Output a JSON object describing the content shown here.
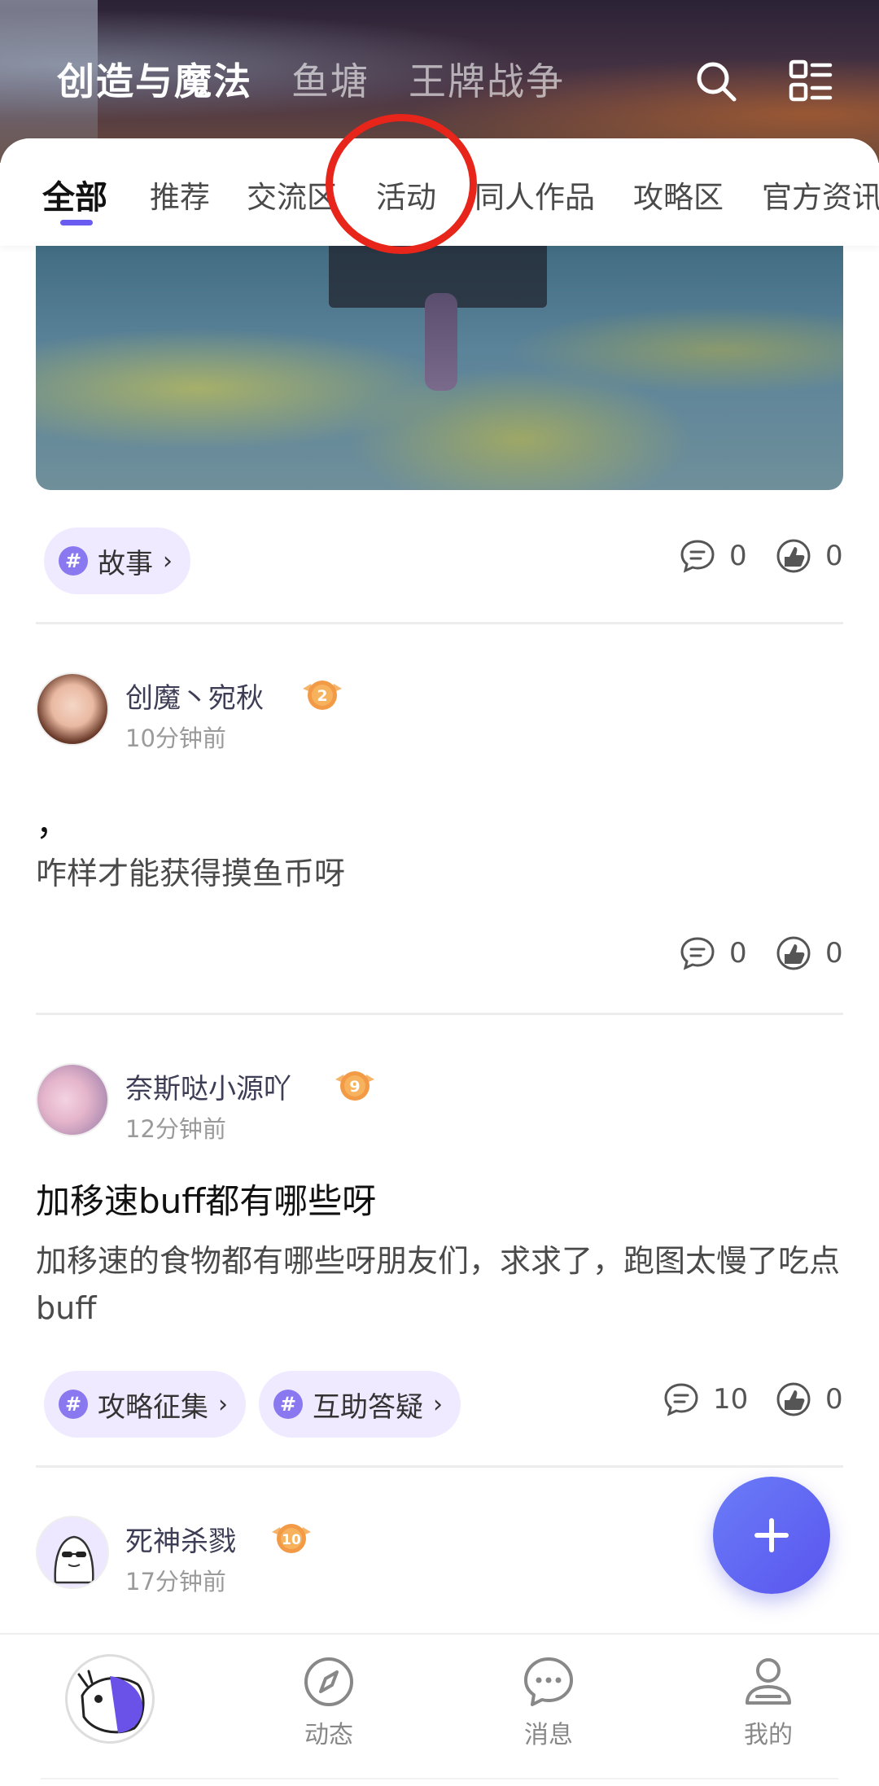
{
  "header": {
    "game_tabs": [
      "创造与魔法",
      "鱼塘",
      "王牌战争"
    ],
    "active_game_tab": 0
  },
  "section_tabs": {
    "items": [
      "全部",
      "推荐",
      "交流区",
      "活动",
      "同人作品",
      "攻略区",
      "官方资讯"
    ],
    "active": 0
  },
  "posts": [
    {
      "tags": [
        "故事"
      ],
      "comments": "0",
      "likes": "0"
    },
    {
      "username": "创魔丶宛秋",
      "level": "2",
      "time": "10分钟前",
      "title": "，",
      "body": "咋样才能获得摸鱼币呀",
      "comments": "0",
      "likes": "0"
    },
    {
      "username": "奈斯哒小源吖",
      "level": "9",
      "time": "12分钟前",
      "title": "加移速buff都有哪些呀",
      "body": "加移速的食物都有哪些呀朋友们，求求了，跑图太慢了吃点buff",
      "tags": [
        "攻略征集",
        "互助答疑"
      ],
      "comments": "10",
      "likes": "0"
    },
    {
      "username": "死神杀戮",
      "level": "10",
      "time": "17分钟前"
    }
  ],
  "bottom_nav": {
    "items": [
      "动态",
      "消息",
      "我的"
    ]
  },
  "colors": {
    "accent": "#6a5cf0",
    "tag_bg": "#efeaff",
    "badge_orange": "#f29a45",
    "highlight_ring": "#e8251a"
  }
}
